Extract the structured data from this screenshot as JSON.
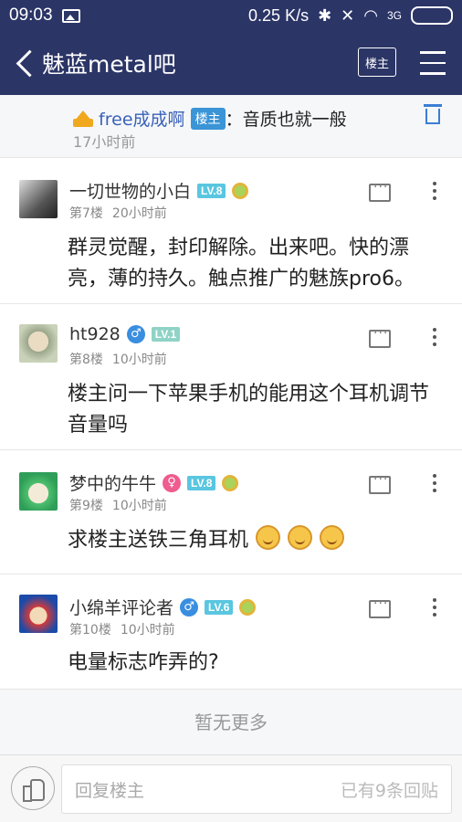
{
  "status_bar": {
    "time": "09:03",
    "net_speed": "0.25 K/s",
    "signal_label": "3G",
    "battery_level": 1.0
  },
  "nav": {
    "title": "魅蓝metal吧",
    "owner_button": "楼主"
  },
  "top_reply": {
    "username": "free成成啊",
    "owner_tag": "楼主",
    "colon": "：",
    "text": "音质也就一般",
    "time": "17小时前"
  },
  "posts": [
    {
      "name": "一切世物的小白",
      "level": "LV.8",
      "floor": "第7楼",
      "time": "20小时前",
      "content": "群灵觉醒，封印解除。出来吧。快的漂亮，薄的持久。触点推广的魅族pro6。"
    },
    {
      "name": "ht928",
      "gender": "♂",
      "level": "LV.1",
      "floor": "第8楼",
      "time": "10小时前",
      "content": "楼主问一下苹果手机的能用这个耳机调节音量吗"
    },
    {
      "name": "梦中的牛牛",
      "gender": "♀",
      "level": "LV.8",
      "floor": "第9楼",
      "time": "10小时前",
      "content": "求楼主送铁三角耳机"
    },
    {
      "name": "小绵羊评论者",
      "gender": "♂",
      "level": "LV.6",
      "floor": "第10楼",
      "time": "10小时前",
      "content": "电量标志咋弄的?"
    }
  ],
  "no_more": "暂无更多",
  "reply_bar": {
    "placeholder": "回复楼主",
    "count": "已有9条回贴"
  },
  "colors": {
    "nav_bg": "#2b3566",
    "accent_blue": "#3a62b8",
    "level_badge": "#5ac6e0"
  }
}
